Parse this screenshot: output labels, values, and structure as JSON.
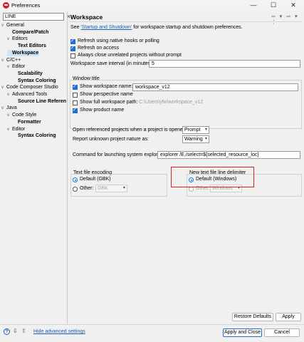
{
  "window": {
    "title": "Preferences",
    "controls": [
      "—",
      "☐",
      "✕"
    ]
  },
  "filter": {
    "value": "LINE",
    "clear_icon": "✕"
  },
  "tree": [
    {
      "label": "General",
      "level": 0,
      "twisty": "v",
      "bold": false
    },
    {
      "label": "Compare/Patch",
      "level": 1,
      "twisty": "",
      "bold": true
    },
    {
      "label": "Editors",
      "level": 1,
      "twisty": "v",
      "bold": false
    },
    {
      "label": "Text Editors",
      "level": 2,
      "twisty": "",
      "bold": true
    },
    {
      "label": "Workspace",
      "level": 1,
      "twisty": "",
      "bold": true,
      "selected": true
    },
    {
      "label": "C/C++",
      "level": 0,
      "twisty": "v",
      "bold": false
    },
    {
      "label": "Editor",
      "level": 1,
      "twisty": "v",
      "bold": false
    },
    {
      "label": "Scalability",
      "level": 2,
      "twisty": "",
      "bold": true
    },
    {
      "label": "Syntax Coloring",
      "level": 2,
      "twisty": "",
      "bold": true
    },
    {
      "label": "Code Composer Studio",
      "level": 0,
      "twisty": "v",
      "bold": false
    },
    {
      "label": "Advanced Tools",
      "level": 1,
      "twisty": "v",
      "bold": false
    },
    {
      "label": "Source Line Referen",
      "level": 2,
      "twisty": "",
      "bold": true
    },
    {
      "label": "Java",
      "level": 0,
      "twisty": "v",
      "bold": false
    },
    {
      "label": "Code Style",
      "level": 1,
      "twisty": "v",
      "bold": false
    },
    {
      "label": "Formatter",
      "level": 2,
      "twisty": "",
      "bold": true
    },
    {
      "label": "Editor",
      "level": 1,
      "twisty": "v",
      "bold": false
    },
    {
      "label": "Syntax Coloring",
      "level": 2,
      "twisty": "",
      "bold": true
    }
  ],
  "panel": {
    "title": "Workspace",
    "nav_icons": "⇦ ▾ ⇨ ▾ ⋮",
    "intro_pre": "See ",
    "intro_link": "'Startup and Shutdown'",
    "intro_post": " for workspace startup and shutdown preferences.",
    "checkboxes": [
      {
        "label": "Refresh using native hooks or polling",
        "checked": true
      },
      {
        "label": "Refresh on access",
        "checked": true
      },
      {
        "label": "Always close unrelated projects without prompt",
        "checked": false
      }
    ],
    "save_interval": {
      "label": "Workspace save interval (in minutes):",
      "value": "5"
    },
    "window_title": {
      "heading": "Window title",
      "show_workspace_name": {
        "label": "Show workspace name:",
        "checked": true,
        "value": "workspace_v12"
      },
      "show_perspective_name": {
        "label": "Show perspective name",
        "checked": false
      },
      "show_full_path": {
        "label": "Show full workspace path:",
        "checked": false,
        "value": "C:\\Users\\yfw\\workspace_v12"
      },
      "show_product_name": {
        "label": "Show product name",
        "checked": true
      }
    },
    "open_referenced": {
      "label": "Open referenced projects when a project is opened:",
      "value": "Prompt"
    },
    "report_nature": {
      "label": "Report unknown project nature as:",
      "value": "Warning"
    },
    "explorer_cmd": {
      "label": "Command for launching system explorer:",
      "value": "explorer /E,/select=${selected_resource_loc}"
    },
    "text_encoding": {
      "heading": "Text file encoding",
      "default_label": "Default (GBK)",
      "other_label": "Other:",
      "other_value": "GBK"
    },
    "line_delimiter": {
      "heading": "New text file line delimiter",
      "default_label": "Default (Windows)",
      "other_label": "Other:",
      "other_value": "Windows"
    },
    "restore_defaults": "Restore Defaults",
    "apply": "Apply"
  },
  "footer": {
    "help_icon": "?",
    "import_icon": "⇩",
    "export_icon": "⇧",
    "hide_advanced": "Hide advanced settings",
    "apply_close": "Apply and Close",
    "cancel": "Cancel"
  },
  "colors": {
    "accent": "#1f6fd1",
    "highlight_box": "#d9201f",
    "selection": "#cce4f7",
    "link": "#1a5fb4"
  }
}
